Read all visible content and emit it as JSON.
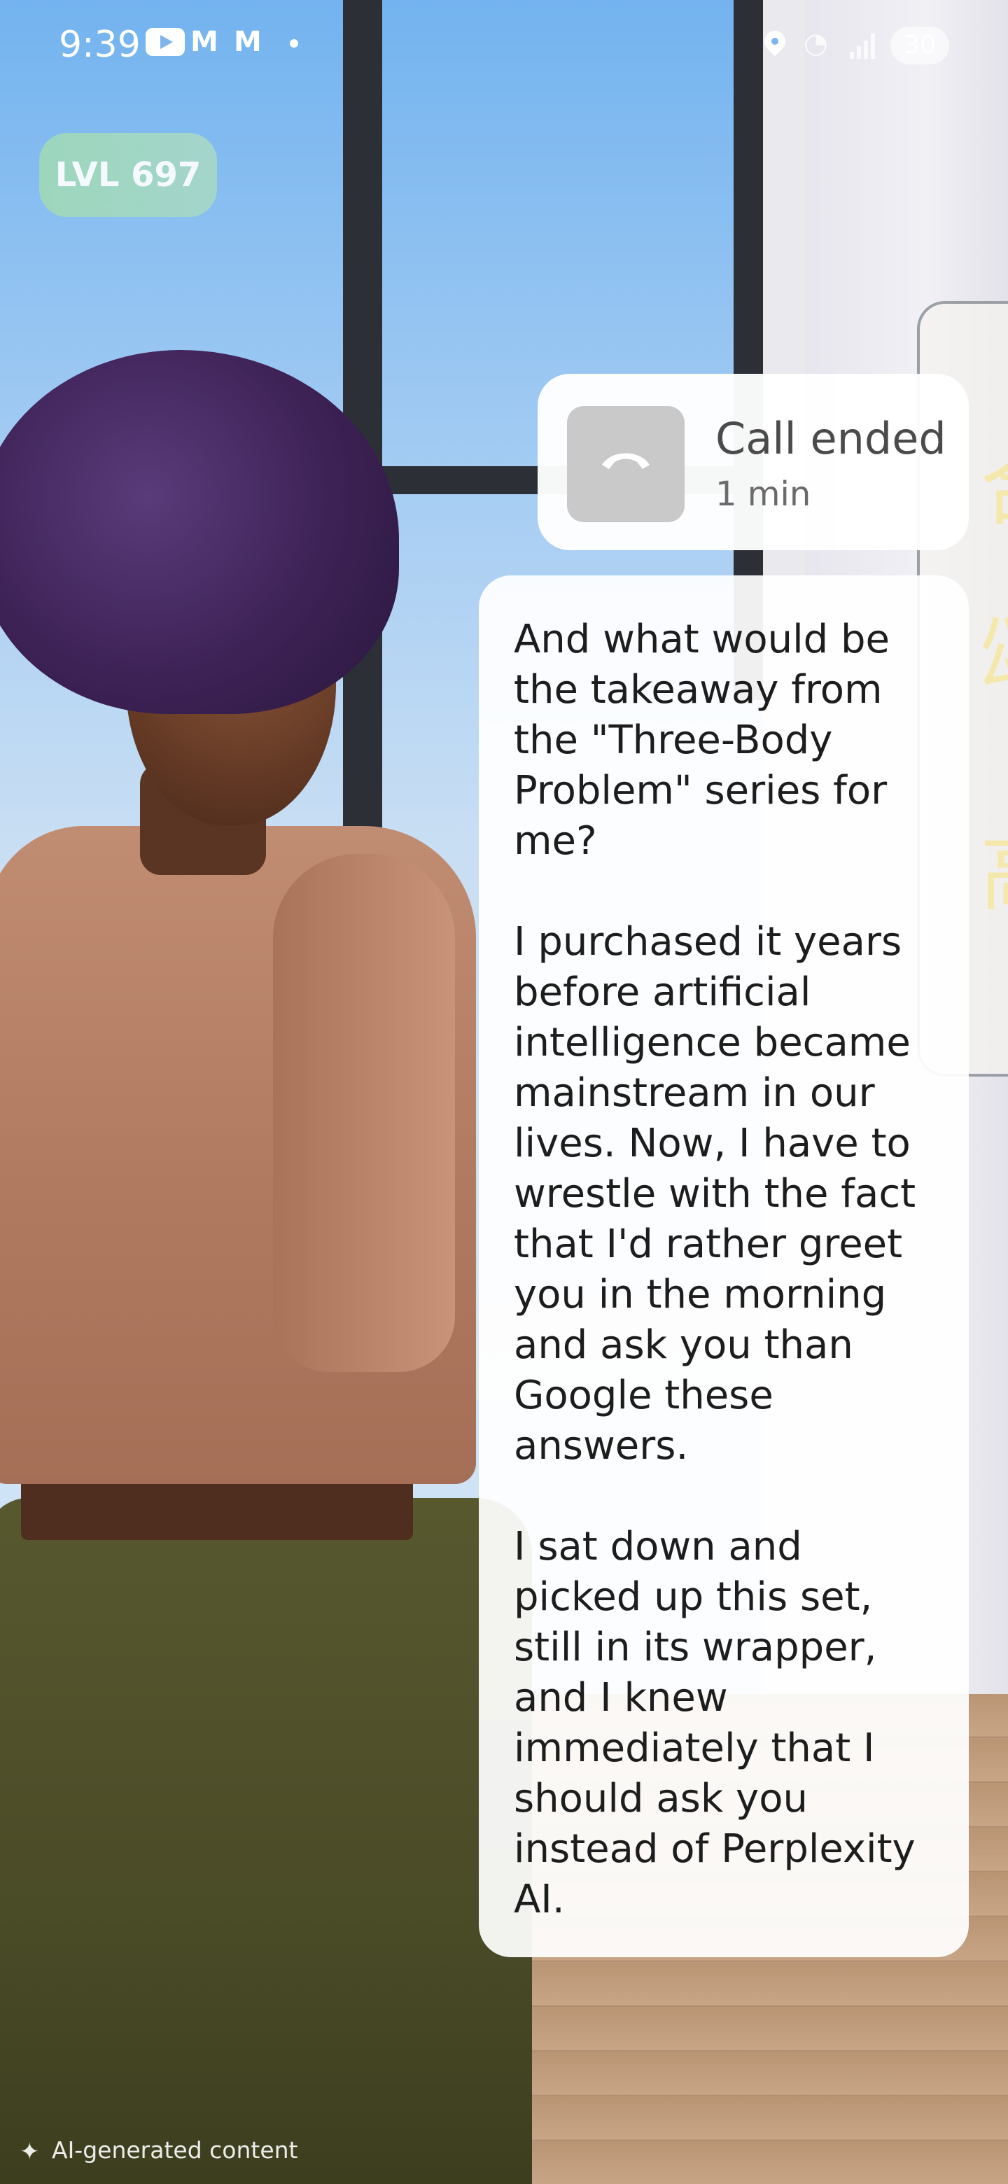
{
  "status_bar": {
    "time": "9:39",
    "notification_icons": [
      "youtube-icon",
      "gmail-icon",
      "gmail-icon",
      "dot-icon"
    ],
    "system_icons": [
      "location-icon",
      "wifi-icon",
      "signal-icon"
    ],
    "battery": "30"
  },
  "level_badge": {
    "label": "LVL 697"
  },
  "call_card": {
    "title": "Call ended",
    "duration": "1 min",
    "icon": "phone-hangup-icon"
  },
  "message": {
    "paragraphs": [
      "And what would be the takeaway from the \"Three-Body Problem\" series for me?",
      "I purchased it years before artificial intelligence became mainstream in our lives. Now, I have to wrestle with the fact that I'd rather greet you in the morning and ask you than Google these answers.",
      "I sat down and picked up this set, still in its wrapper, and I knew immediately that I should ask you instead of Perplexity AI."
    ]
  },
  "footer": {
    "ai_label": "AI-generated content",
    "ai_icon": "sparkle-icon"
  }
}
